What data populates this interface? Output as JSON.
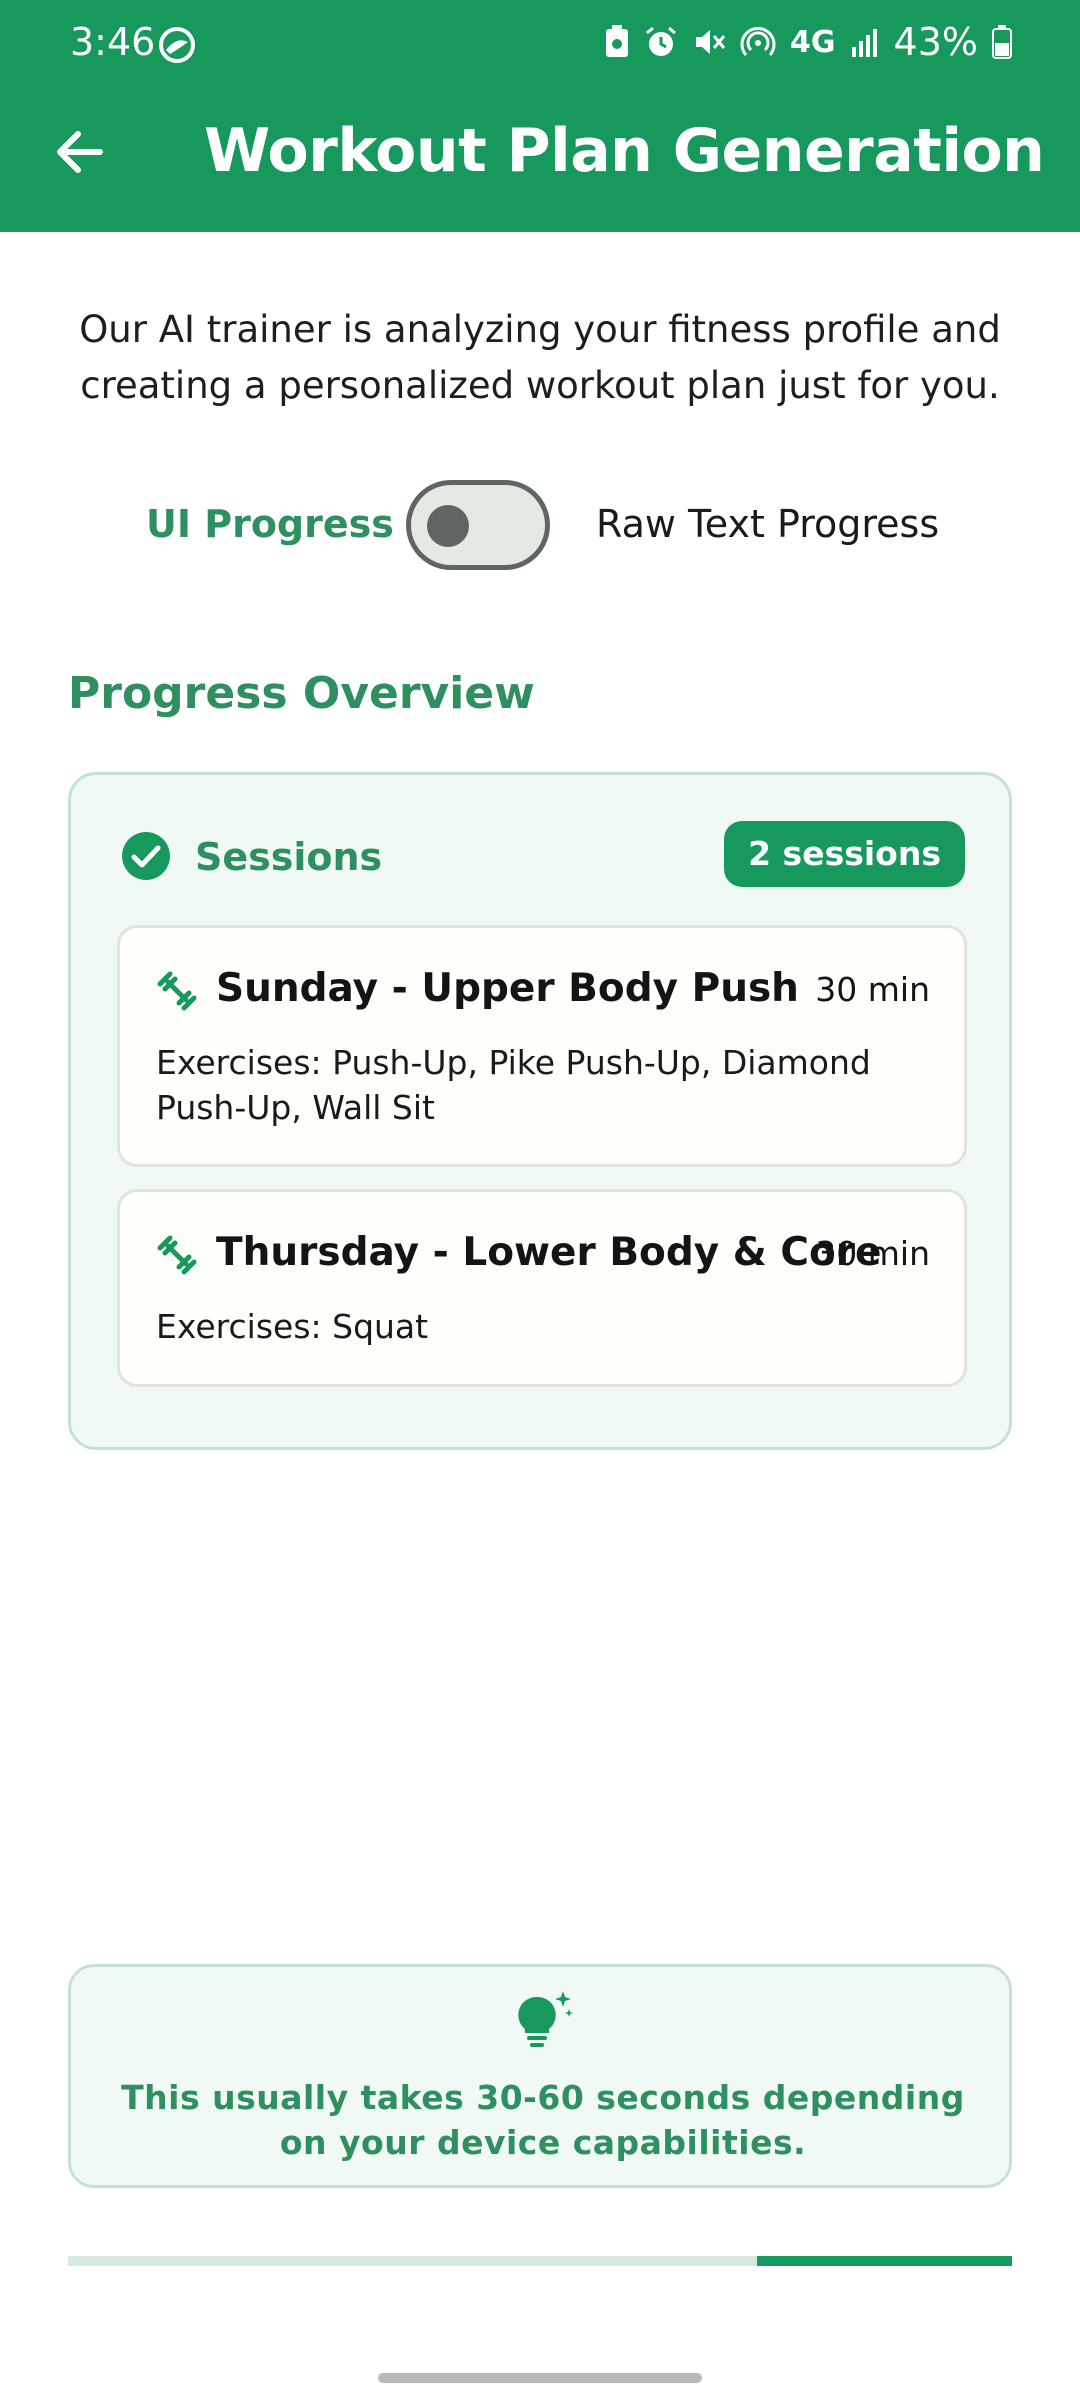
{
  "status_bar": {
    "time": "3:46",
    "battery": "43%",
    "network": "4G"
  },
  "app_bar": {
    "title": "Workout Plan Generation",
    "back_icon": "arrow-back-icon"
  },
  "intro_text": "Our AI trainer is analyzing your fitness profile and creating a personalized workout plan just for you.",
  "toggle": {
    "left_label": "UI Progress",
    "right_label": "Raw Text Progress",
    "is_on": false
  },
  "section_title": "Progress Overview",
  "sessions_card": {
    "label": "Sessions",
    "badge": "2 sessions",
    "sessions": [
      {
        "name": "Sunday - Upper Body Push",
        "duration": "30 min",
        "exercises": "Exercises: Push-Up, Pike Push-Up, Diamond Push-Up, Wall Sit"
      },
      {
        "name": "Thursday - Lower Body & Core",
        "duration": "30 min",
        "exercises": "Exercises: Squat"
      }
    ]
  },
  "tip": {
    "text": "This usually takes 30-60 seconds depending on your device capabilities.",
    "icon": "lightbulb-sparkle-icon"
  },
  "progress": {
    "value_fraction": 0.27,
    "fill_side": "right"
  },
  "colors": {
    "primary": "#17985c",
    "accent_text": "#2e8f5f",
    "card_border": "#c5e2d6",
    "card_bg": "#f1f9f5"
  }
}
